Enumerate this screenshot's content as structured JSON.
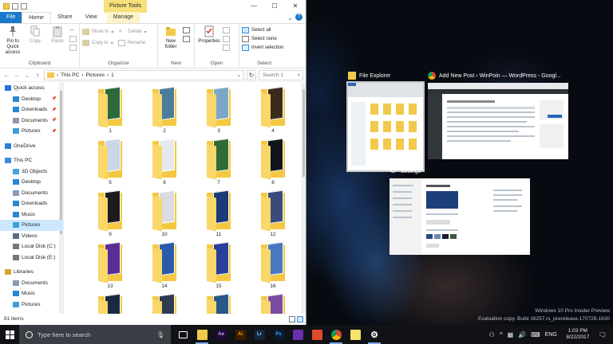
{
  "explorer": {
    "context_tab_header": "Picture Tools",
    "tabs": [
      {
        "label": "File"
      },
      {
        "label": "Home"
      },
      {
        "label": "Share"
      },
      {
        "label": "View"
      },
      {
        "label": "Manage"
      }
    ],
    "ribbon": {
      "clipboard": {
        "label": "Clipboard",
        "pin": "Pin to Quick access",
        "copy": "Copy",
        "paste": "Paste"
      },
      "organize": {
        "label": "Organize",
        "move_to": "Move to",
        "copy_to": "Copy to",
        "delete": "Delete",
        "rename": "Rename"
      },
      "new": {
        "label": "New",
        "new_folder": "New folder"
      },
      "open": {
        "label": "Open",
        "properties": "Properties"
      },
      "select": {
        "label": "Select",
        "select_all": "Select all",
        "select_none": "Select none",
        "invert": "Invert selection"
      }
    },
    "address": {
      "segments": [
        "This PC",
        "Pictures",
        "1"
      ],
      "search_placeholder": "Search 1"
    },
    "nav": [
      {
        "label": "Quick access",
        "level": 1,
        "icon": "star-icon",
        "color": "#1e78d2"
      },
      {
        "label": "Desktop",
        "level": 2,
        "icon": "desktop-icon",
        "color": "#2a86d8",
        "pinned": true
      },
      {
        "label": "Downloads",
        "level": 2,
        "icon": "download-icon",
        "color": "#2a86d8",
        "pinned": true
      },
      {
        "label": "Documents",
        "level": 2,
        "icon": "documents-icon",
        "color": "#8a9bb0",
        "pinned": true
      },
      {
        "label": "Pictures",
        "level": 2,
        "icon": "pictures-icon",
        "color": "#3aa0d8",
        "pinned": true
      },
      {
        "gap": true
      },
      {
        "label": "OneDrive",
        "level": 1,
        "icon": "cloud-icon",
        "color": "#2a7fd4"
      },
      {
        "gap": true
      },
      {
        "label": "This PC",
        "level": 1,
        "icon": "computer-icon",
        "color": "#3a90d8"
      },
      {
        "label": "3D Objects",
        "level": 2,
        "icon": "cube-icon",
        "color": "#4aa0e0"
      },
      {
        "label": "Desktop",
        "level": 2,
        "icon": "desktop-icon",
        "color": "#2a86d8"
      },
      {
        "label": "Documents",
        "level": 2,
        "icon": "documents-icon",
        "color": "#8a9bb0"
      },
      {
        "label": "Downloads",
        "level": 2,
        "icon": "download-icon",
        "color": "#2a86d8"
      },
      {
        "label": "Music",
        "level": 2,
        "icon": "music-icon",
        "color": "#2a86d8"
      },
      {
        "label": "Pictures",
        "level": 2,
        "icon": "pictures-icon",
        "color": "#3aa0d8",
        "selected": true
      },
      {
        "label": "Videos",
        "level": 2,
        "icon": "video-icon",
        "color": "#5a6c84"
      },
      {
        "label": "Local Disk (C:)",
        "level": 2,
        "icon": "drive-icon",
        "color": "#777"
      },
      {
        "label": "Local Disk (E:)",
        "level": 2,
        "icon": "drive-icon",
        "color": "#777"
      },
      {
        "gap": true
      },
      {
        "label": "Libraries",
        "level": 1,
        "icon": "library-icon",
        "color": "#d6a431"
      },
      {
        "label": "Documents",
        "level": 2,
        "icon": "documents-icon",
        "color": "#8a9bb0"
      },
      {
        "label": "Music",
        "level": 2,
        "icon": "music-icon",
        "color": "#2a86d8"
      },
      {
        "label": "Pictures",
        "level": 2,
        "icon": "pictures-icon",
        "color": "#3aa0d8"
      }
    ],
    "folders": [
      {
        "name": "1",
        "color": "#2b6a3a"
      },
      {
        "name": "2",
        "color": "#4a7d9a"
      },
      {
        "name": "3",
        "color": "#7aa7c8"
      },
      {
        "name": "4",
        "color": "#3b2b1c"
      },
      {
        "name": "5",
        "color": "#c9d7e6"
      },
      {
        "name": "6",
        "color": "#e6eaee"
      },
      {
        "name": "7",
        "color": "#2f6b3a"
      },
      {
        "name": "8",
        "color": "#111418"
      },
      {
        "name": "9",
        "color": "#1c1c1c"
      },
      {
        "name": "10",
        "color": "#d9dde2"
      },
      {
        "name": "11",
        "color": "#1a3a7a"
      },
      {
        "name": "12",
        "color": "#3a4a7a"
      },
      {
        "name": "13",
        "color": "#5a2c9a"
      },
      {
        "name": "14",
        "color": "#2a5aaa"
      },
      {
        "name": "15",
        "color": "#2a3f9a"
      },
      {
        "name": "16",
        "color": "#4a78c0"
      },
      {
        "name": "",
        "color": "#1a2a44"
      },
      {
        "name": "",
        "color": "#303a50"
      },
      {
        "name": "",
        "color": "#28588a"
      },
      {
        "name": "",
        "color": "#7a4aa0"
      }
    ],
    "status": "81 items"
  },
  "taskview": {
    "cards": [
      {
        "title": "File Explorer"
      },
      {
        "title": "Add New Post ‹ WinPoin — WordPress - Googl..."
      },
      {
        "title": "Settings"
      }
    ]
  },
  "watermark": {
    "line1": "Windows 10 Pro Insider Preview",
    "line2": "Evaluation copy. Build 16257.rs_prerelease.170728-1630"
  },
  "taskbar": {
    "search_placeholder": "Type here to search",
    "apps": [
      {
        "name": "task-view-icon",
        "label": "",
        "bg": "transparent",
        "fg": "#ffffff",
        "running": false
      },
      {
        "name": "file-explorer-icon",
        "label": "",
        "bg": "#f2c94c",
        "fg": "#333",
        "running": true
      },
      {
        "name": "after-effects-icon",
        "label": "Ae",
        "bg": "#1f0a3a",
        "fg": "#c9a4ff",
        "running": false
      },
      {
        "name": "illustrator-icon",
        "label": "Ai",
        "bg": "#3a1e00",
        "fg": "#ff9a00",
        "running": false
      },
      {
        "name": "lightroom-icon",
        "label": "Lr",
        "bg": "#14243a",
        "fg": "#8cc8ff",
        "running": false
      },
      {
        "name": "photoshop-icon",
        "label": "Ps",
        "bg": "#0a1a30",
        "fg": "#31a8ff",
        "running": false
      },
      {
        "name": "visual-studio-icon",
        "label": "",
        "bg": "#6a2fb0",
        "fg": "#ffffff",
        "running": false
      },
      {
        "name": "office-icon",
        "label": "",
        "bg": "#e04a2a",
        "fg": "#ffffff",
        "running": false
      },
      {
        "name": "chrome-icon",
        "label": "",
        "bg": "#ffffff",
        "fg": "#db4437",
        "running": true
      },
      {
        "name": "sticky-notes-icon",
        "label": "",
        "bg": "#f5e36a",
        "fg": "#333",
        "running": false
      },
      {
        "name": "settings-icon",
        "label": "",
        "bg": "transparent",
        "fg": "#ffffff",
        "running": true
      }
    ],
    "lang": "ENG",
    "time": "1:03 PM",
    "date": "8/22/2017"
  }
}
